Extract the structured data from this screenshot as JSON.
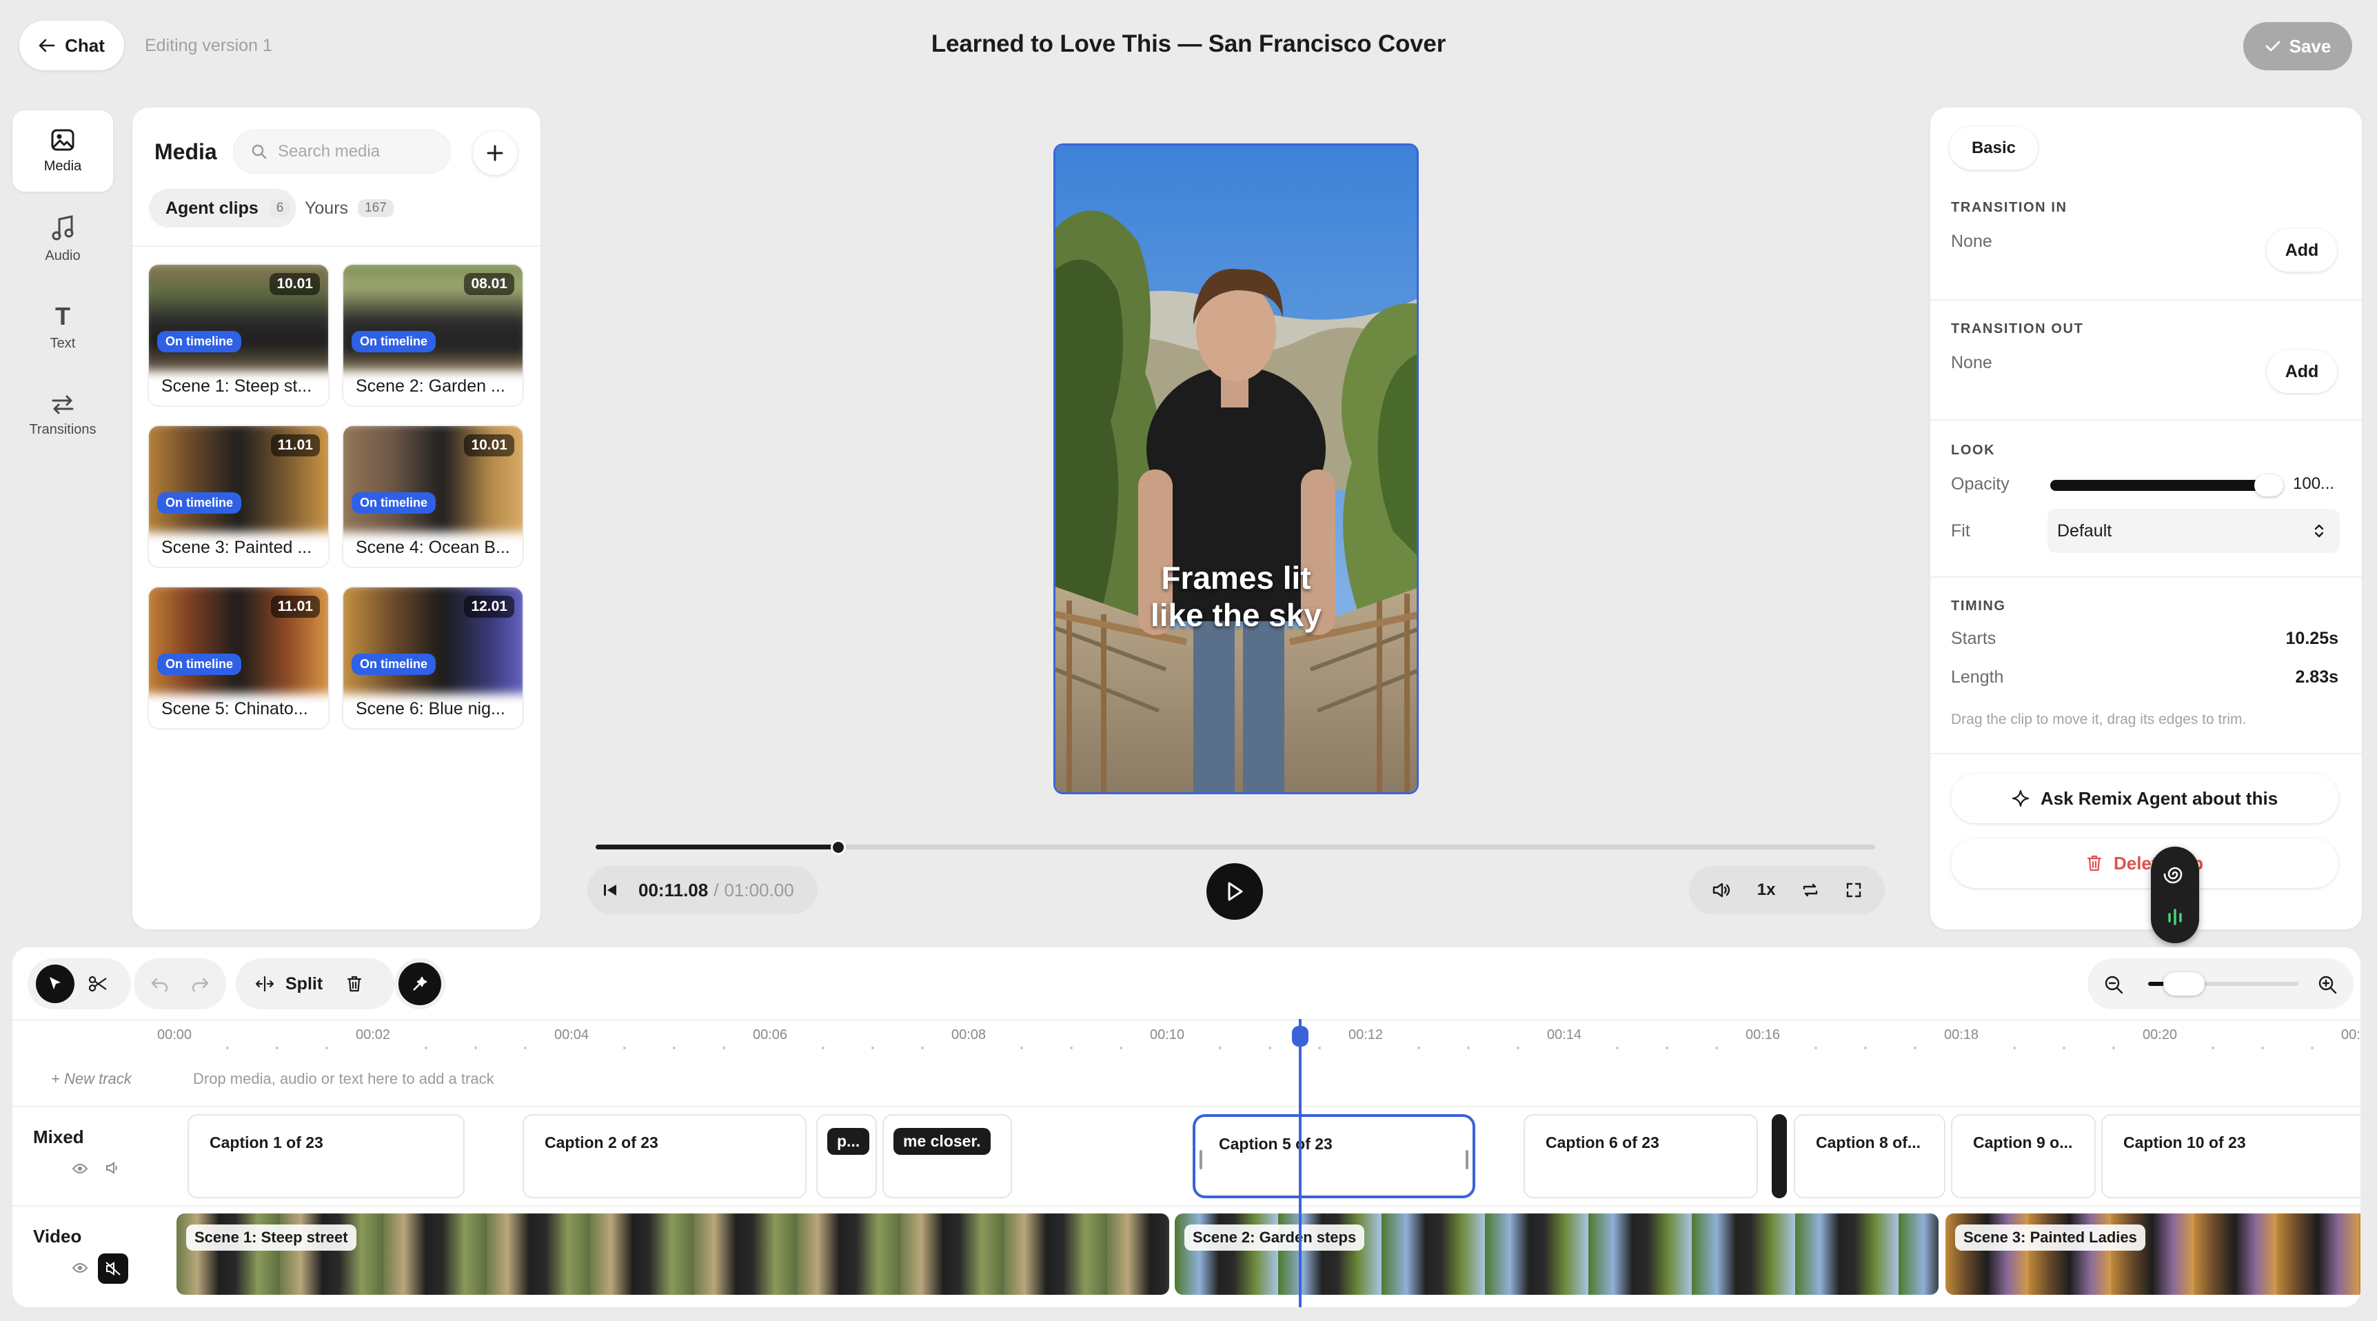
{
  "topbar": {
    "back_label": "Chat",
    "editing_label": "Editing version 1",
    "title": "Learned to Love This — San Francisco Cover",
    "save_label": "Save"
  },
  "rail": [
    {
      "label": "Media",
      "icon": "image-icon"
    },
    {
      "label": "Audio",
      "icon": "music-note-icon"
    },
    {
      "label": "Text",
      "icon": "text-t-icon"
    },
    {
      "label": "Transitions",
      "icon": "arrows-swap-icon"
    }
  ],
  "media": {
    "title": "Media",
    "search_placeholder": "Search media",
    "tabs": [
      {
        "label": "Agent clips",
        "count": "6"
      },
      {
        "label": "Yours",
        "count": "167"
      }
    ],
    "on_timeline_label": "On timeline",
    "clips": [
      {
        "name": "Scene 1: Steep st...",
        "duration": "10.01"
      },
      {
        "name": "Scene 2: Garden ...",
        "duration": "08.01"
      },
      {
        "name": "Scene 3: Painted ...",
        "duration": "11.01"
      },
      {
        "name": "Scene 4: Ocean B...",
        "duration": "10.01"
      },
      {
        "name": "Scene 5: Chinato...",
        "duration": "11.01"
      },
      {
        "name": "Scene 6: Blue nig...",
        "duration": "12.01"
      }
    ]
  },
  "preview": {
    "caption_line1": "Frames lit",
    "caption_line2": "like the sky",
    "current_time": "00:11.08",
    "separator": "/",
    "total_time": "01:00.00",
    "progress": 0.19,
    "speed": "1x"
  },
  "props": {
    "tab": "Basic",
    "transition_in": {
      "heading": "TRANSITION IN",
      "value": "None",
      "button": "Add"
    },
    "transition_out": {
      "heading": "TRANSITION OUT",
      "value": "None",
      "button": "Add"
    },
    "look": {
      "heading": "LOOK",
      "opacity_label": "Opacity",
      "opacity_value": "100...",
      "fit_label": "Fit",
      "fit_value": "Default"
    },
    "timing": {
      "heading": "TIMING",
      "starts_label": "Starts",
      "starts_value": "10.25s",
      "length_label": "Length",
      "length_value": "2.83s",
      "hint": "Drag the clip to move it, drag its edges to trim."
    },
    "ask_label": "Ask Remix Agent about this",
    "delete_label": "Delete clip"
  },
  "timeline": {
    "split_label": "Split",
    "ticks": [
      "00:00",
      "00:02",
      "00:04",
      "00:06",
      "00:08",
      "00:10",
      "00:12",
      "00:14",
      "00:16",
      "00:18",
      "00:20",
      "00:"
    ],
    "new_track": "+ New track",
    "drop_hint": "Drop media, audio or text here to add a track",
    "tracks": [
      {
        "name": "Mixed"
      },
      {
        "name": "Video"
      }
    ],
    "captions": [
      "Caption 1 of 23",
      "Caption 2 of 23",
      "p...",
      "me closer.",
      "Caption 5 of 23",
      "Caption 6 of 23",
      "Caption 8 of...",
      "Caption 9 o...",
      "Caption 10 of 23"
    ],
    "video_clips": [
      "Scene 1: Steep street",
      "Scene 2: Garden steps",
      "Scene 3: Painted Ladies"
    ]
  },
  "colors": {
    "accent": "#3b63d8",
    "on_timeline": "#2f61e6",
    "delete": "#e0524f"
  }
}
